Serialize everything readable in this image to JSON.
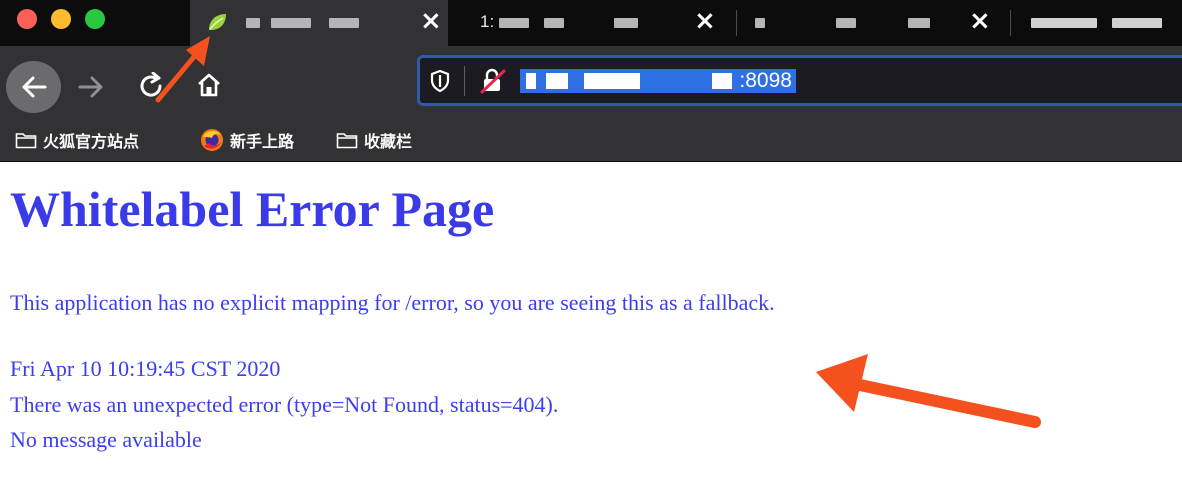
{
  "browser": {
    "tabs": [
      {
        "title": "",
        "close_icon": "×",
        "active": true,
        "favicon": "spring-leaf-icon"
      },
      {
        "title": "1:",
        "close_icon": "×",
        "active": false
      },
      {
        "title": "",
        "close_icon": "×",
        "active": false
      },
      {
        "title": "",
        "active": false
      }
    ],
    "address_bar": {
      "url_suffix": ":8098",
      "shield_icon": "tracking-protection-shield-icon",
      "lock_icon": "insecure-lock-icon"
    },
    "nav_icons": [
      "back-arrow-icon",
      "forward-arrow-icon",
      "reload-icon",
      "home-icon"
    ],
    "bookmarks": [
      {
        "label": "火狐官方站点",
        "icon": "folder-icon"
      },
      {
        "label": "新手上路",
        "icon": "firefox-logo-icon"
      },
      {
        "label": "收藏栏",
        "icon": "folder-icon"
      }
    ],
    "colors": {
      "tabstrip": "#0c0c0d",
      "toolbar": "#323234",
      "urlbar_focus": "#2e5aa8",
      "url_selection": "#2f6fe4"
    }
  },
  "page": {
    "title": "Whitelabel Error Page",
    "message": "This application has no explicit mapping for /error, so you are seeing this as a fallback.",
    "timestamp": "Fri Apr 10 10:19:45 CST 2020",
    "error_line": "There was an unexpected error (type=Not Found, status=404).",
    "detail": "No message available",
    "text_color": "#3d3df0"
  },
  "annotations": {
    "arrow_color": "#f4511e",
    "arrows": [
      "arrow-to-favicon",
      "arrow-to-error-details"
    ]
  }
}
